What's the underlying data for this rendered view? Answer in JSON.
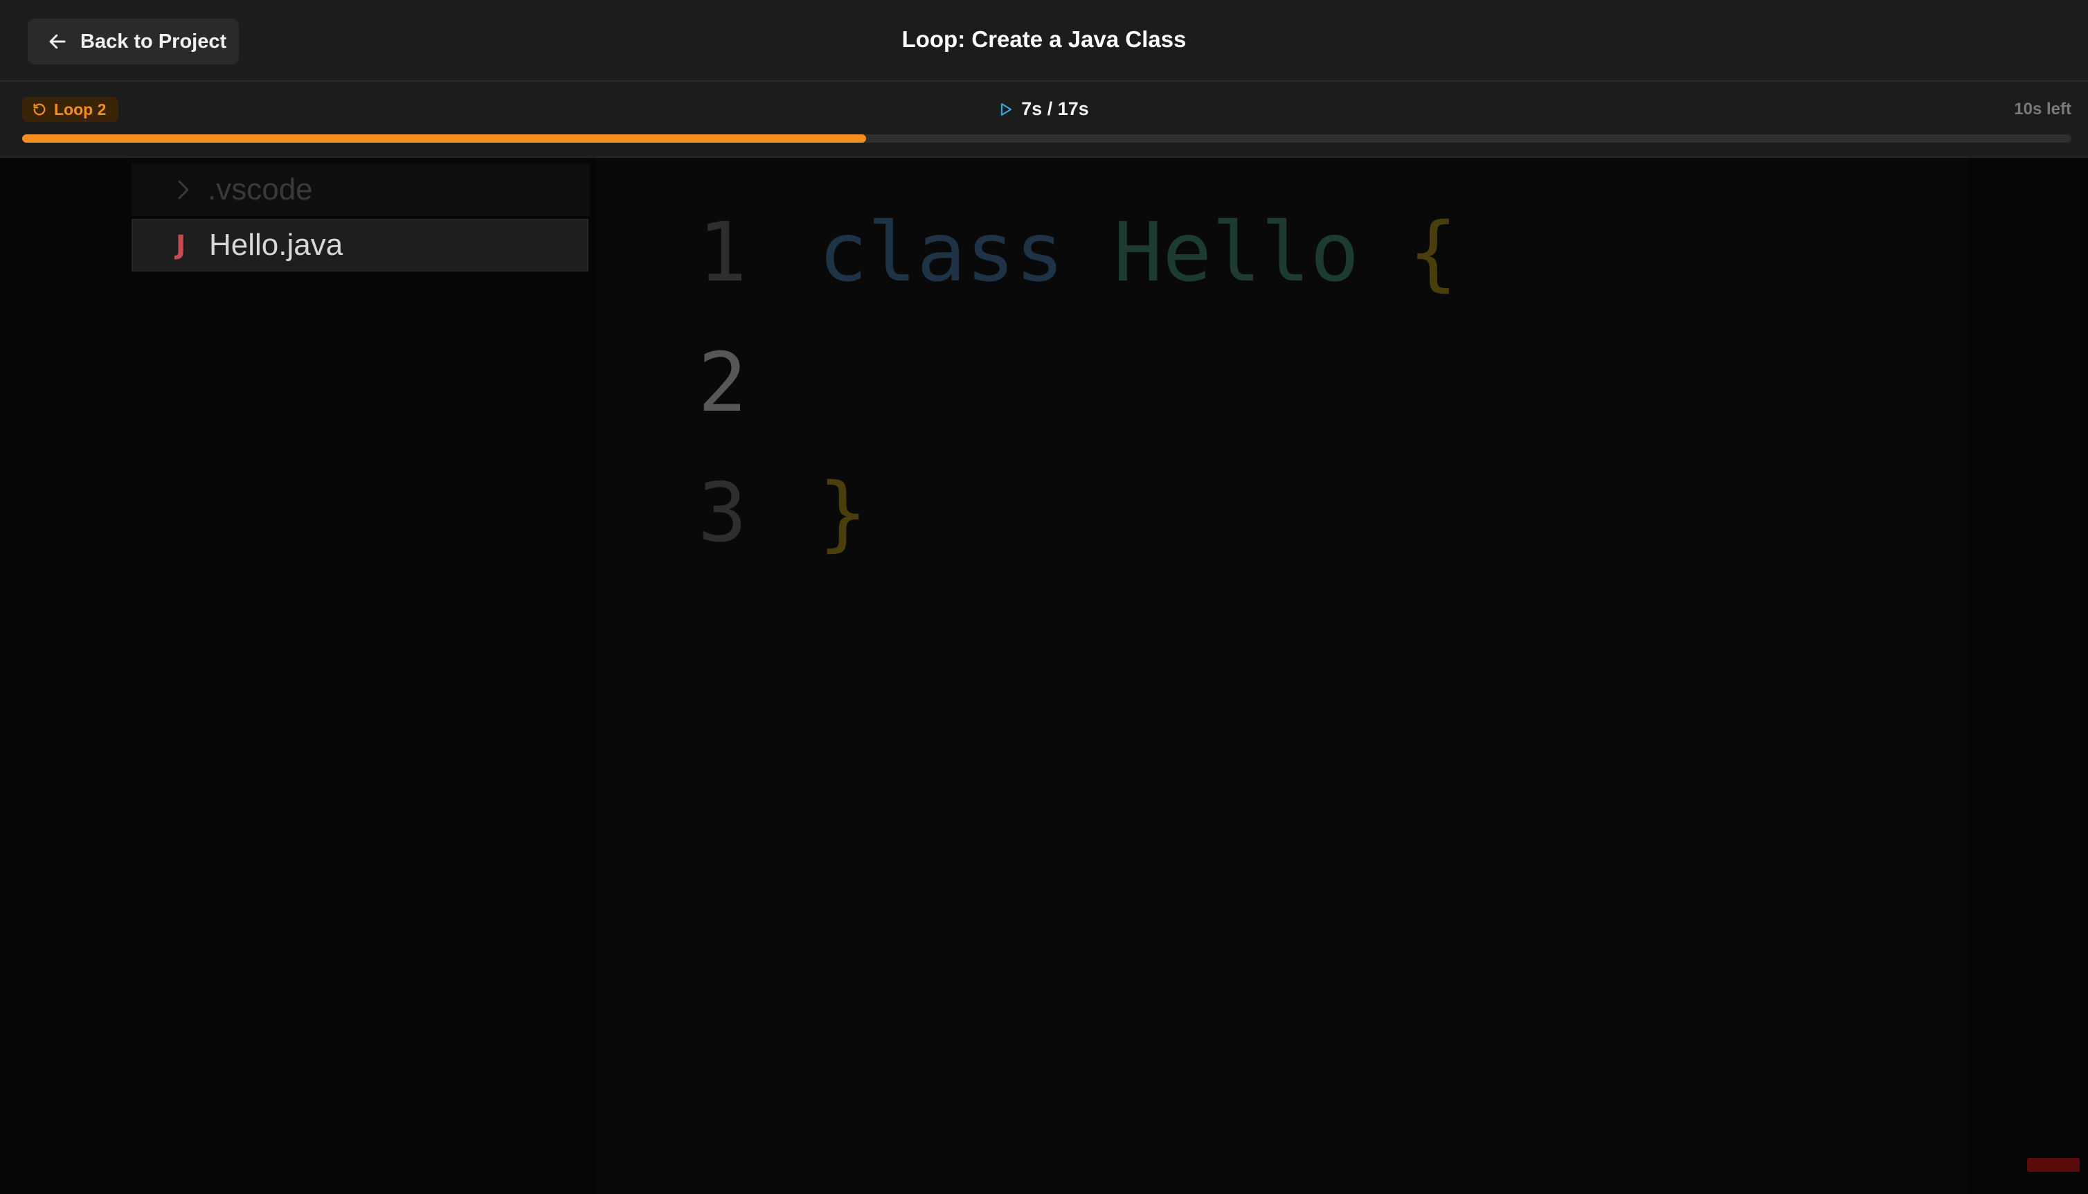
{
  "header": {
    "back_label": "Back to Project",
    "title": "Loop: Create a Java Class"
  },
  "progress": {
    "loop_label": "Loop 2",
    "time_readout": "7s / 17s",
    "time_left": "10s left",
    "elapsed_seconds": 7,
    "total_seconds": 17,
    "accent_color": "#f5901e"
  },
  "explorer": {
    "folder": ".vscode",
    "file": "Hello.java",
    "file_icon": "J"
  },
  "editor": {
    "lines": [
      {
        "number": "1",
        "keyword": "class",
        "name": "Hello",
        "brace": "{"
      },
      {
        "number": "2"
      },
      {
        "number": "3",
        "brace": "}"
      }
    ]
  },
  "icons": {
    "back": "arrow-left-icon",
    "loop": "loop-icon",
    "play": "play-icon",
    "folder_chevron": "chevron-right-icon",
    "java": "java-file-icon"
  }
}
